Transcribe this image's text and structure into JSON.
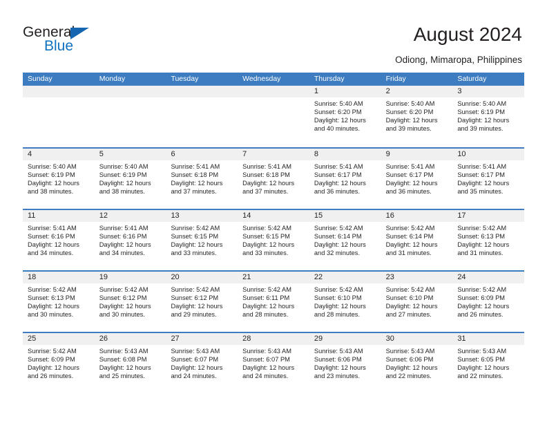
{
  "brand": {
    "name_top": "General",
    "name_bottom": "Blue",
    "triangle_color": "#1565b0",
    "blue_color": "#1071c0"
  },
  "header": {
    "title": "August 2024",
    "subtitle": "Odiong, Mimaropa, Philippines"
  },
  "theme": {
    "header_bg": "#3d7cc0",
    "daynum_bg": "#f0f0f0",
    "text": "#231f20"
  },
  "weekdays": [
    "Sunday",
    "Monday",
    "Tuesday",
    "Wednesday",
    "Thursday",
    "Friday",
    "Saturday"
  ],
  "weeks": [
    [
      {
        "day": "",
        "sunrise": "",
        "sunset": "",
        "daylight": "",
        "daylight2": "",
        "empty": true
      },
      {
        "day": "",
        "sunrise": "",
        "sunset": "",
        "daylight": "",
        "daylight2": "",
        "empty": true
      },
      {
        "day": "",
        "sunrise": "",
        "sunset": "",
        "daylight": "",
        "daylight2": "",
        "empty": true
      },
      {
        "day": "",
        "sunrise": "",
        "sunset": "",
        "daylight": "",
        "daylight2": "",
        "empty": true
      },
      {
        "day": "1",
        "sunrise": "Sunrise: 5:40 AM",
        "sunset": "Sunset: 6:20 PM",
        "daylight": "Daylight: 12 hours",
        "daylight2": "and 40 minutes.",
        "empty": false
      },
      {
        "day": "2",
        "sunrise": "Sunrise: 5:40 AM",
        "sunset": "Sunset: 6:20 PM",
        "daylight": "Daylight: 12 hours",
        "daylight2": "and 39 minutes.",
        "empty": false
      },
      {
        "day": "3",
        "sunrise": "Sunrise: 5:40 AM",
        "sunset": "Sunset: 6:19 PM",
        "daylight": "Daylight: 12 hours",
        "daylight2": "and 39 minutes.",
        "empty": false
      }
    ],
    [
      {
        "day": "4",
        "sunrise": "Sunrise: 5:40 AM",
        "sunset": "Sunset: 6:19 PM",
        "daylight": "Daylight: 12 hours",
        "daylight2": "and 38 minutes.",
        "empty": false
      },
      {
        "day": "5",
        "sunrise": "Sunrise: 5:40 AM",
        "sunset": "Sunset: 6:19 PM",
        "daylight": "Daylight: 12 hours",
        "daylight2": "and 38 minutes.",
        "empty": false
      },
      {
        "day": "6",
        "sunrise": "Sunrise: 5:41 AM",
        "sunset": "Sunset: 6:18 PM",
        "daylight": "Daylight: 12 hours",
        "daylight2": "and 37 minutes.",
        "empty": false
      },
      {
        "day": "7",
        "sunrise": "Sunrise: 5:41 AM",
        "sunset": "Sunset: 6:18 PM",
        "daylight": "Daylight: 12 hours",
        "daylight2": "and 37 minutes.",
        "empty": false
      },
      {
        "day": "8",
        "sunrise": "Sunrise: 5:41 AM",
        "sunset": "Sunset: 6:17 PM",
        "daylight": "Daylight: 12 hours",
        "daylight2": "and 36 minutes.",
        "empty": false
      },
      {
        "day": "9",
        "sunrise": "Sunrise: 5:41 AM",
        "sunset": "Sunset: 6:17 PM",
        "daylight": "Daylight: 12 hours",
        "daylight2": "and 36 minutes.",
        "empty": false
      },
      {
        "day": "10",
        "sunrise": "Sunrise: 5:41 AM",
        "sunset": "Sunset: 6:17 PM",
        "daylight": "Daylight: 12 hours",
        "daylight2": "and 35 minutes.",
        "empty": false
      }
    ],
    [
      {
        "day": "11",
        "sunrise": "Sunrise: 5:41 AM",
        "sunset": "Sunset: 6:16 PM",
        "daylight": "Daylight: 12 hours",
        "daylight2": "and 34 minutes.",
        "empty": false
      },
      {
        "day": "12",
        "sunrise": "Sunrise: 5:41 AM",
        "sunset": "Sunset: 6:16 PM",
        "daylight": "Daylight: 12 hours",
        "daylight2": "and 34 minutes.",
        "empty": false
      },
      {
        "day": "13",
        "sunrise": "Sunrise: 5:42 AM",
        "sunset": "Sunset: 6:15 PM",
        "daylight": "Daylight: 12 hours",
        "daylight2": "and 33 minutes.",
        "empty": false
      },
      {
        "day": "14",
        "sunrise": "Sunrise: 5:42 AM",
        "sunset": "Sunset: 6:15 PM",
        "daylight": "Daylight: 12 hours",
        "daylight2": "and 33 minutes.",
        "empty": false
      },
      {
        "day": "15",
        "sunrise": "Sunrise: 5:42 AM",
        "sunset": "Sunset: 6:14 PM",
        "daylight": "Daylight: 12 hours",
        "daylight2": "and 32 minutes.",
        "empty": false
      },
      {
        "day": "16",
        "sunrise": "Sunrise: 5:42 AM",
        "sunset": "Sunset: 6:14 PM",
        "daylight": "Daylight: 12 hours",
        "daylight2": "and 31 minutes.",
        "empty": false
      },
      {
        "day": "17",
        "sunrise": "Sunrise: 5:42 AM",
        "sunset": "Sunset: 6:13 PM",
        "daylight": "Daylight: 12 hours",
        "daylight2": "and 31 minutes.",
        "empty": false
      }
    ],
    [
      {
        "day": "18",
        "sunrise": "Sunrise: 5:42 AM",
        "sunset": "Sunset: 6:13 PM",
        "daylight": "Daylight: 12 hours",
        "daylight2": "and 30 minutes.",
        "empty": false
      },
      {
        "day": "19",
        "sunrise": "Sunrise: 5:42 AM",
        "sunset": "Sunset: 6:12 PM",
        "daylight": "Daylight: 12 hours",
        "daylight2": "and 30 minutes.",
        "empty": false
      },
      {
        "day": "20",
        "sunrise": "Sunrise: 5:42 AM",
        "sunset": "Sunset: 6:12 PM",
        "daylight": "Daylight: 12 hours",
        "daylight2": "and 29 minutes.",
        "empty": false
      },
      {
        "day": "21",
        "sunrise": "Sunrise: 5:42 AM",
        "sunset": "Sunset: 6:11 PM",
        "daylight": "Daylight: 12 hours",
        "daylight2": "and 28 minutes.",
        "empty": false
      },
      {
        "day": "22",
        "sunrise": "Sunrise: 5:42 AM",
        "sunset": "Sunset: 6:10 PM",
        "daylight": "Daylight: 12 hours",
        "daylight2": "and 28 minutes.",
        "empty": false
      },
      {
        "day": "23",
        "sunrise": "Sunrise: 5:42 AM",
        "sunset": "Sunset: 6:10 PM",
        "daylight": "Daylight: 12 hours",
        "daylight2": "and 27 minutes.",
        "empty": false
      },
      {
        "day": "24",
        "sunrise": "Sunrise: 5:42 AM",
        "sunset": "Sunset: 6:09 PM",
        "daylight": "Daylight: 12 hours",
        "daylight2": "and 26 minutes.",
        "empty": false
      }
    ],
    [
      {
        "day": "25",
        "sunrise": "Sunrise: 5:42 AM",
        "sunset": "Sunset: 6:09 PM",
        "daylight": "Daylight: 12 hours",
        "daylight2": "and 26 minutes.",
        "empty": false
      },
      {
        "day": "26",
        "sunrise": "Sunrise: 5:43 AM",
        "sunset": "Sunset: 6:08 PM",
        "daylight": "Daylight: 12 hours",
        "daylight2": "and 25 minutes.",
        "empty": false
      },
      {
        "day": "27",
        "sunrise": "Sunrise: 5:43 AM",
        "sunset": "Sunset: 6:07 PM",
        "daylight": "Daylight: 12 hours",
        "daylight2": "and 24 minutes.",
        "empty": false
      },
      {
        "day": "28",
        "sunrise": "Sunrise: 5:43 AM",
        "sunset": "Sunset: 6:07 PM",
        "daylight": "Daylight: 12 hours",
        "daylight2": "and 24 minutes.",
        "empty": false
      },
      {
        "day": "29",
        "sunrise": "Sunrise: 5:43 AM",
        "sunset": "Sunset: 6:06 PM",
        "daylight": "Daylight: 12 hours",
        "daylight2": "and 23 minutes.",
        "empty": false
      },
      {
        "day": "30",
        "sunrise": "Sunrise: 5:43 AM",
        "sunset": "Sunset: 6:06 PM",
        "daylight": "Daylight: 12 hours",
        "daylight2": "and 22 minutes.",
        "empty": false
      },
      {
        "day": "31",
        "sunrise": "Sunrise: 5:43 AM",
        "sunset": "Sunset: 6:05 PM",
        "daylight": "Daylight: 12 hours",
        "daylight2": "and 22 minutes.",
        "empty": false
      }
    ]
  ]
}
